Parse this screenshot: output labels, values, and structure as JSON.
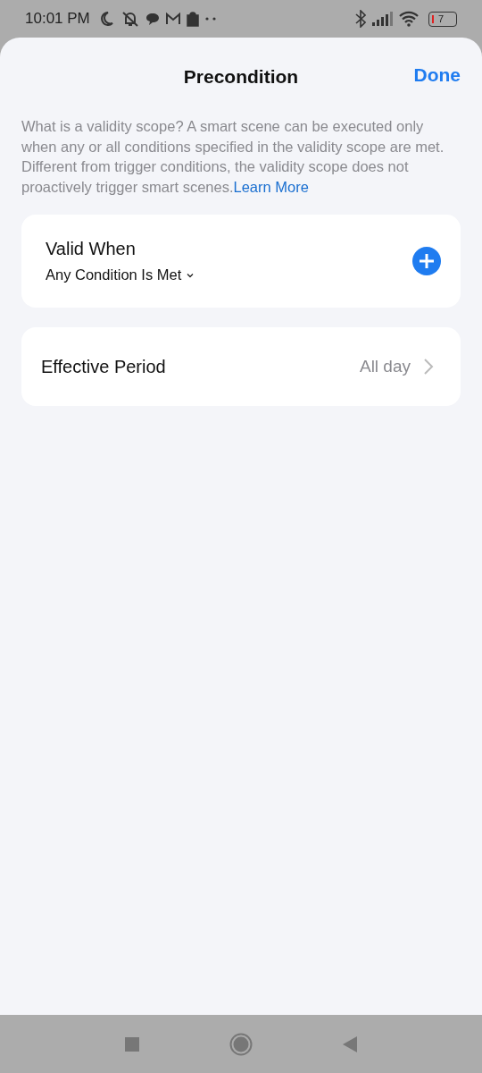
{
  "status_bar": {
    "time": "10:01 PM",
    "battery": "7"
  },
  "header": {
    "title": "Precondition",
    "done": "Done"
  },
  "description": {
    "text": "What is a validity scope? A smart scene can be executed only when any or all conditions specified in the validity scope are met. Different from trigger conditions, the validity scope does not proactively trigger smart scenes.",
    "link": "Learn More"
  },
  "valid_when": {
    "title": "Valid When",
    "mode": "Any Condition Is Met"
  },
  "effective_period": {
    "label": "Effective Period",
    "value": "All day"
  }
}
